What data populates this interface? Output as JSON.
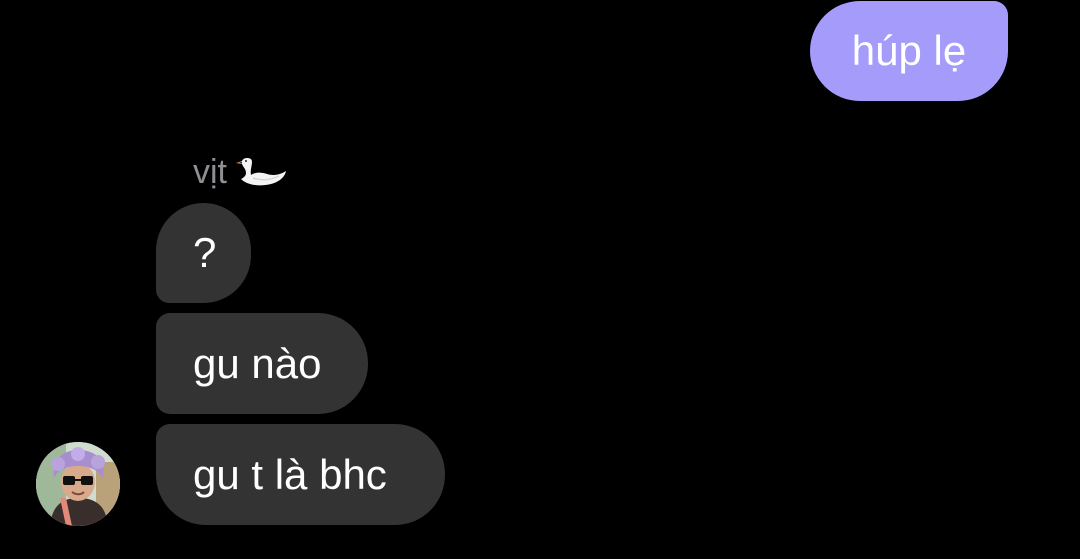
{
  "conversation": {
    "outgoing": [
      {
        "text": "húp lẹ"
      }
    ],
    "sender": {
      "name": "vịt",
      "emoji_icon": "swan-icon"
    },
    "incoming": [
      {
        "text": "?"
      },
      {
        "text": "gu nào"
      },
      {
        "text": "gu t là bhc"
      }
    ],
    "avatar_icon": "user-avatar"
  },
  "colors": {
    "background": "#000000",
    "outgoing_bubble": "#a59bfa",
    "incoming_bubble": "#333333",
    "sender_name": "#8e8e93",
    "text": "#ffffff"
  }
}
